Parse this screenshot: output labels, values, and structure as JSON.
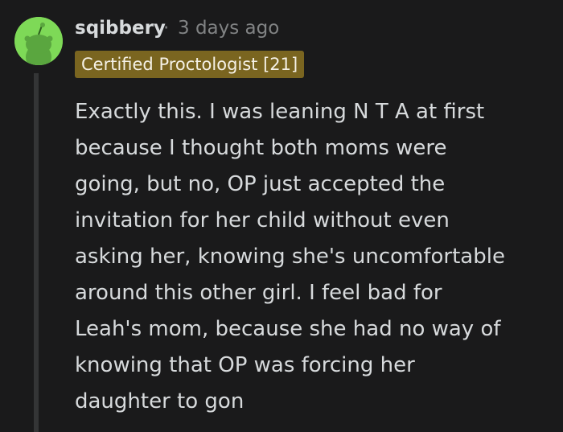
{
  "comment": {
    "username": "sqibbery",
    "separator": "·",
    "timestamp": "3 days ago",
    "flair": "Certified Proctologist [21]",
    "avatar_icon": "reddit-snoo-avatar-icon",
    "colors": {
      "background": "#1a1a1b",
      "avatar": "#7ed957",
      "flair_bg": "#7a6520",
      "text": "#d7dadc",
      "muted": "#818384"
    },
    "body_lines": [
      "Exactly this. I was leaning N T A at first",
      "because I thought both moms were",
      "going, but no, OP just accepted the",
      "invitation for her child without even",
      "asking her, knowing she's uncomfortable",
      "around this other girl. I feel bad for",
      "Leah's mom, because she had no way of",
      "knowing that OP was forcing her",
      "daughter to gon"
    ]
  }
}
